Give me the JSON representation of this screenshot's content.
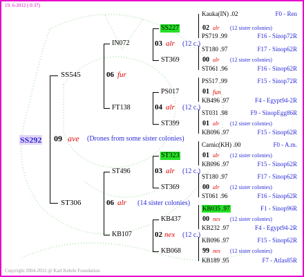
{
  "header": {
    "date": "19. 6-2012 ( 0:37)"
  },
  "footer": {
    "copyright": "Copyright 2004-2012 @ Karl Kehrle Foundation."
  },
  "root": {
    "id": "SS292",
    "gen_num": "09",
    "race": "ave",
    "note": "(Drones from some sister colonies)"
  },
  "gen1": {
    "father": {
      "id": "SS545",
      "num": "06",
      "race": "fur"
    },
    "mother": {
      "id": "ST306",
      "num": "06",
      "race": "alr",
      "note": "(14 sister colonies)"
    }
  },
  "gen2": {
    "ff": {
      "id": "IN072",
      "num": "03",
      "race": "alr",
      "note": "(12 c.)"
    },
    "fm": {
      "id": "FT138",
      "num": "04",
      "race": "alr",
      "note": "(12 c.)"
    },
    "mf": {
      "id": "ST496",
      "num": "03",
      "race": "alr",
      "note": "(12 c.)"
    },
    "mm": {
      "id": "KB107",
      "num": "02",
      "race": "nex",
      "note": "(12 c.)"
    }
  },
  "gen3": {
    "a": "SS227",
    "b": "ST369",
    "c": "PS017",
    "d": "ST399",
    "e": "ST323",
    "f": "ST369",
    "g": "KB437",
    "h": "KB068"
  },
  "gen3_mid": {
    "a": {
      "num": "02",
      "race": "alr",
      "note": "(12 sister colonies)"
    },
    "b": {
      "num": "00",
      "race": "alr",
      "note": "(12 sister colonies)"
    },
    "c": {
      "num": "01",
      "race": "fun",
      "note": ""
    },
    "d": {
      "num": "01",
      "race": "alr",
      "note": "(12 sister colonies)"
    },
    "e": {
      "num": "01",
      "race": "alr",
      "note": "(12 sister colonies)"
    },
    "f": {
      "num": "00",
      "race": "alr",
      "note": "(12 sister colonies)"
    },
    "g": {
      "num": "00",
      "race": "nex",
      "note": "(12 sister colonies)"
    },
    "h": {
      "num": "99",
      "race": "nex",
      "note": "(12 sister colonies)"
    }
  },
  "gen4": [
    {
      "left": "Kauka(IN) .02",
      "right": "F0 - Ren"
    },
    {
      "left": "PS719 .99",
      "right": "F16 - Sinop72R"
    },
    {
      "left": "ST180 .97",
      "right": "F17 - Sinop62R"
    },
    {
      "left": "ST061 .96",
      "right": "F16 - Sinop62R"
    },
    {
      "left": "PS517 .99",
      "right": "F15 - Sinop72R"
    },
    {
      "left": "KB496 .97",
      "right": "F4 - Egypt94-2R"
    },
    {
      "left": "ST031 .98",
      "right": "F9 - SinopEgg86R"
    },
    {
      "left": "KB096 .97",
      "right": "F15 - Sinop62R"
    },
    {
      "left": "Carnic(KH) .00",
      "right": "F0 - A.m."
    },
    {
      "left": "KB096 .97",
      "right": "F15 - Sinop62R"
    },
    {
      "left": "ST180 .97",
      "right": "F17 - Sinop62R"
    },
    {
      "left": "ST061 .96",
      "right": "F16 - Sinop62R"
    },
    {
      "left": "KB035 .97",
      "right": "F1 - Sinop96R"
    },
    {
      "left": "KB232 .97",
      "right": "F4 - Egypt94-2R"
    },
    {
      "left": "KB096 .97",
      "right": "F15 - Sinop62R"
    },
    {
      "left": "KB189 .95",
      "right": "F7 - Atlas85R"
    }
  ],
  "colors": {
    "border": "#e600c8",
    "highlight_green": "#25e025",
    "root_bg": "#e6d6f6",
    "red": "#e00000",
    "blue": "#2a2ad8"
  }
}
